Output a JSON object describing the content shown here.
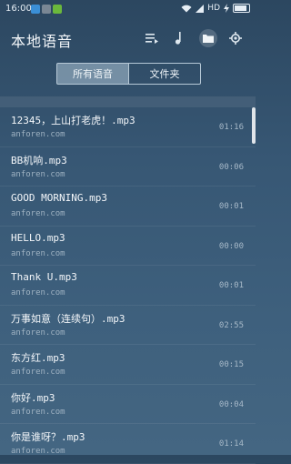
{
  "status": {
    "time": "16:00",
    "network": "HD"
  },
  "header": {
    "title": "本地语音"
  },
  "tabs": [
    {
      "label": "所有语音"
    },
    {
      "label": "文件夹"
    }
  ],
  "items": [
    {
      "name": "12345，上山打老虎！.mp3",
      "source": "anforen.com",
      "duration": "01:16"
    },
    {
      "name": "BB机响.mp3",
      "source": "anforen.com",
      "duration": "00:06"
    },
    {
      "name": "GOOD MORNING.mp3",
      "source": "anforen.com",
      "duration": "00:01"
    },
    {
      "name": "HELLO.mp3",
      "source": "anforen.com",
      "duration": "00:00"
    },
    {
      "name": "Thank U.mp3",
      "source": "anforen.com",
      "duration": "00:01"
    },
    {
      "name": "万事如意（连续句）.mp3",
      "source": "anforen.com",
      "duration": "02:55"
    },
    {
      "name": "东方红.mp3",
      "source": "anforen.com",
      "duration": "00:15"
    },
    {
      "name": "你好.mp3",
      "source": "anforen.com",
      "duration": "00:04"
    },
    {
      "name": "你是谁呀？.mp3",
      "source": "anforen.com",
      "duration": "01:14"
    }
  ]
}
